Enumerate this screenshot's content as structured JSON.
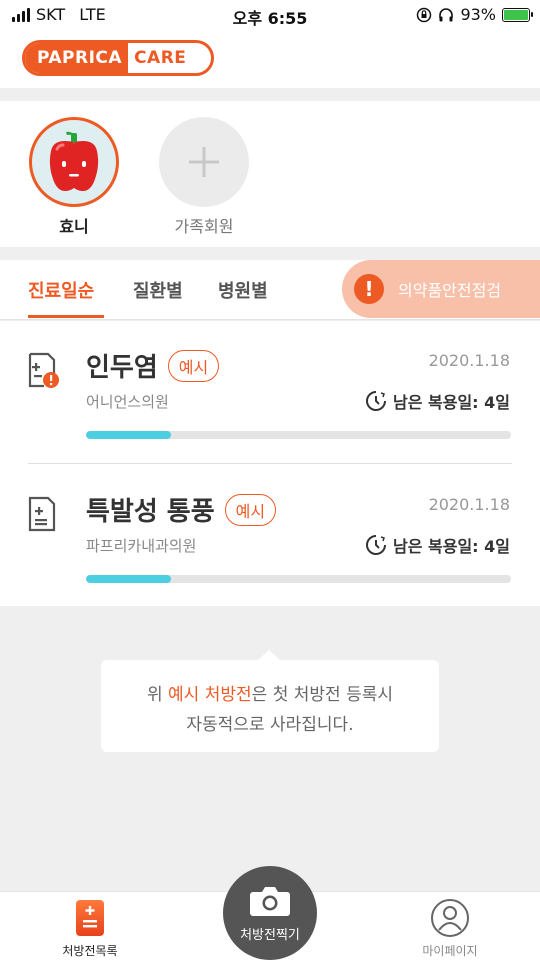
{
  "status_bar": {
    "carrier": "SKT",
    "network": "LTE",
    "time": "오후 6:55",
    "battery": "93%"
  },
  "header": {
    "logo_left": "PAPRICA",
    "logo_right": "CARE"
  },
  "members": [
    {
      "name": "효니",
      "avatar": "red-pepper-avatar"
    },
    {
      "name": "가족회원",
      "icon": "plus-icon"
    }
  ],
  "tabs": [
    "진료일순",
    "질환별",
    "병원별"
  ],
  "safety_check": {
    "label": "의약품안전점검",
    "icon": "exclamation-icon"
  },
  "prescriptions": [
    {
      "title": "인두염",
      "badge": "예시",
      "hospital": "어니언스의원",
      "date": "2020.1.18",
      "remaining": "남은 복용일: 4일",
      "progress": 0.2,
      "icon": "prescription-alert-icon"
    },
    {
      "title": "특발성 통풍",
      "badge": "예시",
      "hospital": "파프리카내과의원",
      "date": "2020.1.18",
      "remaining": "남은 복용일: 4일",
      "progress": 0.2,
      "icon": "prescription-icon"
    }
  ],
  "tooltip": {
    "prefix": "위 ",
    "highlight": "예시 처방전",
    "suffix": "은 첫 처방전 등록시",
    "line2": "자동적으로 사라집니다."
  },
  "nav": {
    "left": "처방전목록",
    "center": "처방전찍기",
    "right": "마이페이지"
  },
  "colors": {
    "accent": "#ee5a24",
    "progress": "#4ccfe0"
  }
}
